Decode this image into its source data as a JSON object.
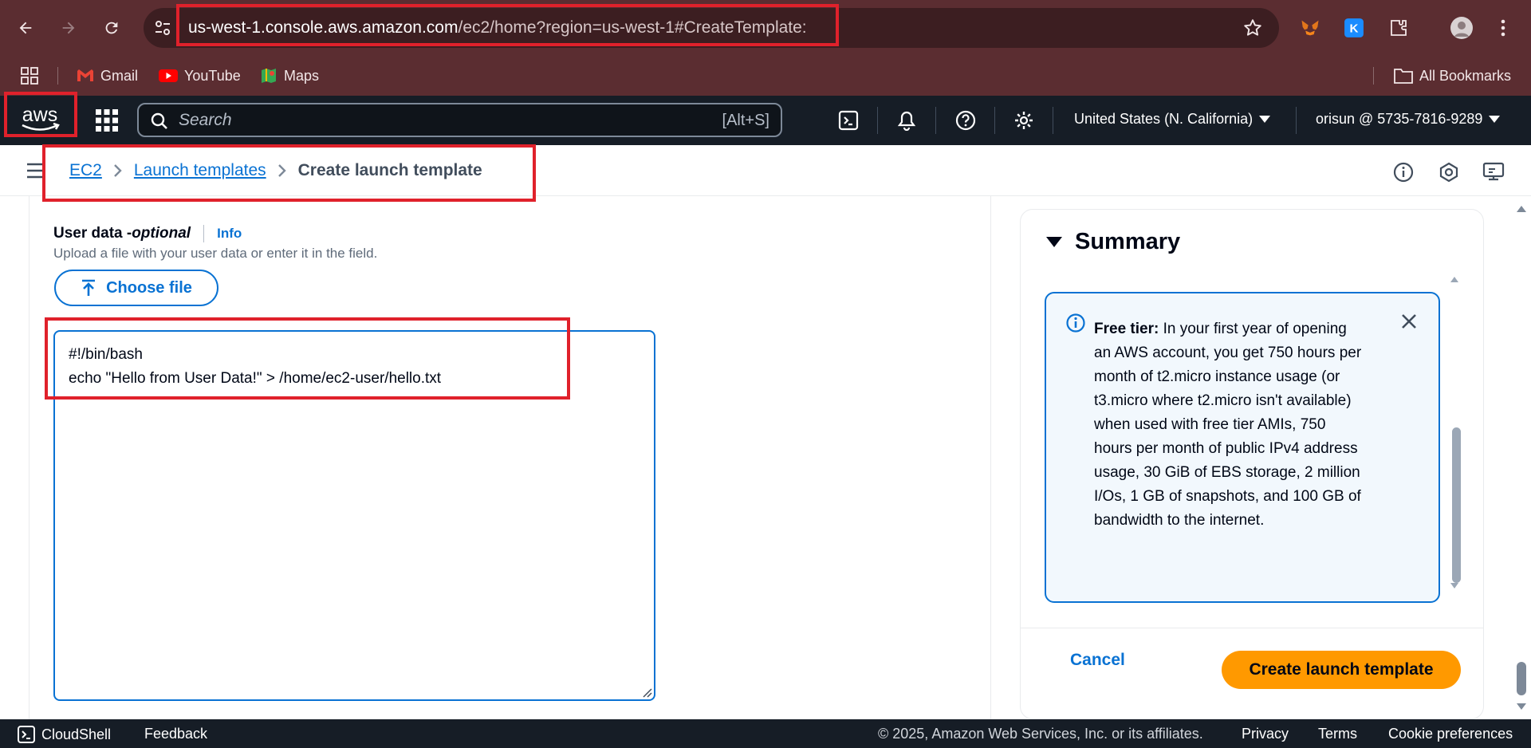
{
  "browser": {
    "url_host": "us-west-1.console.aws.amazon.com",
    "url_path": "/ec2/home?region=us-west-1#CreateTemplate:",
    "bookmarks": [
      "Gmail",
      "YouTube",
      "Maps"
    ],
    "all_bookmarks": "All Bookmarks"
  },
  "aws_header": {
    "logo": "aws",
    "search_placeholder": "Search",
    "search_shortcut": "[Alt+S]",
    "region": "United States (N. California)",
    "account": "orisun @ 5735-7816-9289"
  },
  "breadcrumb": {
    "items": [
      "EC2",
      "Launch templates"
    ],
    "current": "Create launch template"
  },
  "user_data": {
    "label": "User data - ",
    "label_optional": "optional",
    "info": "Info",
    "description": "Upload a file with your user data or enter it in the field.",
    "choose_file": "Choose file",
    "content": "#!/bin/bash\necho \"Hello from User Data!\" > /home/ec2-user/hello.txt\n"
  },
  "summary": {
    "title": "Summary",
    "free_tier_label": "Free tier:",
    "free_tier_text": " In your first year of opening an AWS account, you get 750 hours per month of t2.micro instance usage (or t3.micro where t2.micro isn't available) when used with free tier AMIs, 750 hours per month of public IPv4 address usage, 30 GiB of EBS storage, 2 million I/Os, 1 GB of snapshots, and 100 GB of bandwidth to the internet.",
    "cancel": "Cancel",
    "create": "Create launch template"
  },
  "footer": {
    "cloudshell": "CloudShell",
    "feedback": "Feedback",
    "copyright": "© 2025, Amazon Web Services, Inc. or its affiliates.",
    "privacy": "Privacy",
    "terms": "Terms",
    "cookies": "Cookie preferences"
  },
  "colors": {
    "chrome": "#5b2d31",
    "aws_nav": "#161d26",
    "link": "#0972d3",
    "primary_button": "#ff9900",
    "highlight": "#e0212b"
  }
}
